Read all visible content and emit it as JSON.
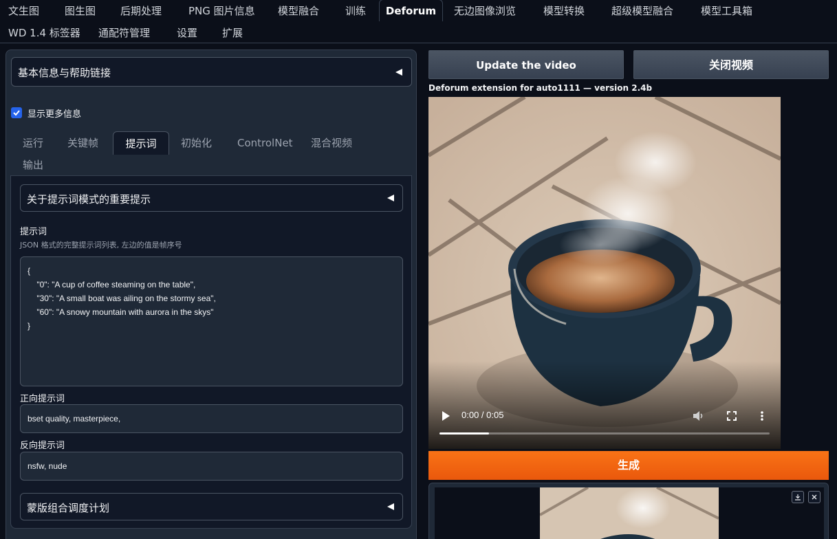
{
  "top_tabs": {
    "row1": [
      "文生图",
      "图生图",
      "后期处理",
      "PNG 图片信息",
      "模型融合",
      "训练",
      "Deforum",
      "无边图像浏览",
      "模型转换",
      "超级模型融合",
      "模型工具箱"
    ],
    "row2": [
      "WD 1.4 标签器",
      "通配符管理",
      "设置",
      "扩展"
    ],
    "active": "Deforum"
  },
  "left": {
    "info_accordion": "基本信息与帮助链接",
    "show_more_info": {
      "label": "显示更多信息",
      "checked": true
    },
    "sub_tabs": [
      "运行",
      "关键帧",
      "提示词",
      "初始化",
      "ControlNet",
      "混合视频",
      "输出"
    ],
    "active_sub_tab": "提示词",
    "prompt_mode_accordion": "关于提示词模式的重要提示",
    "prompts": {
      "label": "提示词",
      "description": "JSON 格式的完整提示词列表, 左边的值是帧序号",
      "value": "{\n    \"0\": \"A cup of coffee steaming on the table\",\n    \"30\": \"A small boat was ailing on the stormy sea\",\n    \"60\": \"A snowy mountain with aurora in the skys\"\n}"
    },
    "positive": {
      "label": "正向提示词",
      "value": "bset quality, masterpiece,"
    },
    "negative": {
      "label": "反向提示词",
      "value": "nsfw, nude"
    },
    "mask_accordion": "蒙版组合调度计划"
  },
  "right": {
    "update_video_button": "Update the video",
    "close_video_button": "关闭视频",
    "version_text": "Deforum extension for auto1111 — version 2.4b",
    "video": {
      "time": "0:00 / 0:05",
      "progress": 0.15,
      "icons": [
        "play-icon",
        "volume-icon",
        "fullscreen-icon",
        "more-options-icon"
      ]
    },
    "generate_button": "生成",
    "gallery_icons": [
      "download-icon",
      "close-icon"
    ]
  },
  "colors": {
    "background": "#0b0f19",
    "panel": "#1f2937",
    "accent_orange": "#f97316",
    "checkbox_blue": "#2563eb"
  }
}
